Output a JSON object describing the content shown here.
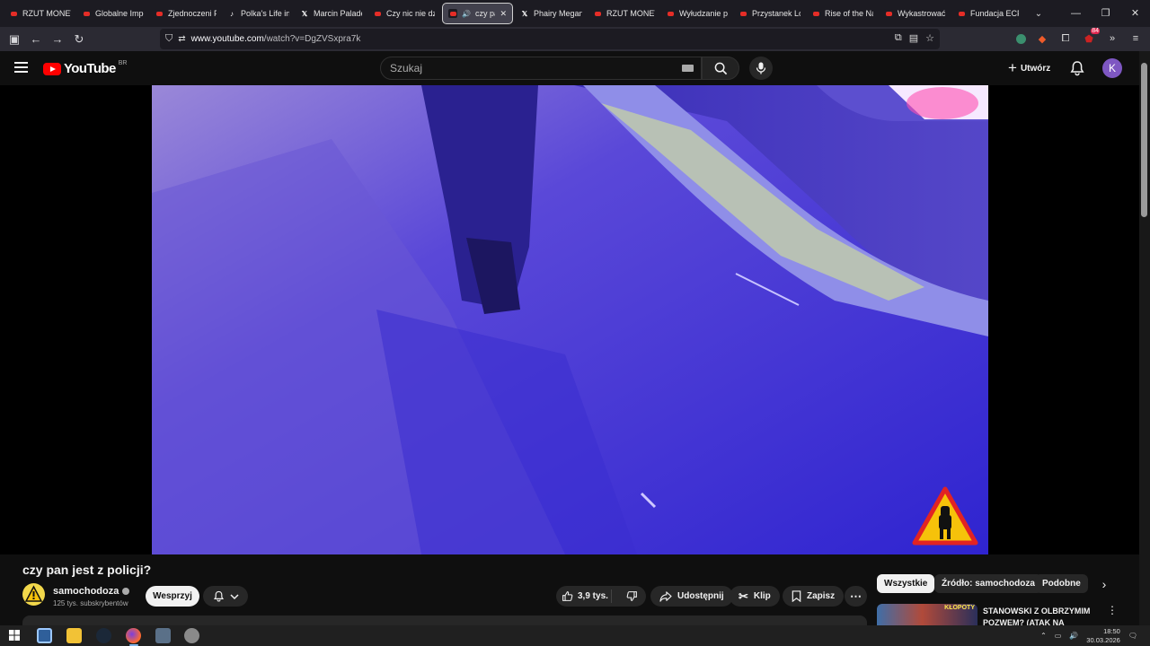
{
  "browser": {
    "tabs": [
      {
        "title": "RZUT MONETA",
        "icon": "youtube-icon"
      },
      {
        "title": "Globalne Impe",
        "icon": "youtube-icon"
      },
      {
        "title": "Zjednoczeni Pr",
        "icon": "youtube-icon"
      },
      {
        "title": "Polka's Life in",
        "icon": "tiktok-icon"
      },
      {
        "title": "Marcin Palade",
        "icon": "x-icon"
      },
      {
        "title": "Czy nic nie dzi",
        "icon": "youtube-icon"
      },
      {
        "title": "czy pan",
        "icon": "youtube-icon",
        "active": true
      },
      {
        "title": "Phairy Megan",
        "icon": "x-icon"
      },
      {
        "title": "RZUT MONETA",
        "icon": "youtube-icon"
      },
      {
        "title": "Wyłudzanie pie",
        "icon": "youtube-icon"
      },
      {
        "title": "Przystanek Lon",
        "icon": "youtube-icon"
      },
      {
        "title": "Rise of the Na",
        "icon": "youtube-icon"
      },
      {
        "title": "Wykastrować I",
        "icon": "youtube-icon"
      },
      {
        "title": "Fundacja ECPU",
        "icon": "youtube-icon"
      }
    ],
    "url_domain": "www.youtube.com",
    "url_path": "/watch?v=DgZVSxpra7k",
    "extension_badge": "84"
  },
  "youtube": {
    "logo_text": "YouTube",
    "country_code": "BR",
    "search_placeholder": "Szukaj",
    "create_label": "Utwórz",
    "avatar_letter": "K"
  },
  "video": {
    "title": "czy pan jest z policji?",
    "channel_name": "samochodoza",
    "subscribers": "125 tys. subskrybentów",
    "support_label": "Wesprzyj",
    "likes": "3,9 tys.",
    "share_label": "Udostępnij",
    "clip_label": "Klip",
    "save_label": "Zapisz"
  },
  "sidebar": {
    "chips": [
      "Wszystkie",
      "Źródło: samochodoza",
      "Podobne"
    ],
    "recommended": {
      "title": "STANOWSKI Z OLBRZYMIM POZWEM? (ATAK NA",
      "thumb_text": "KŁOPOTY"
    }
  },
  "taskbar": {
    "time": "18:50",
    "date": "30.03.2026"
  },
  "colors": {
    "yt_red": "#ff0000",
    "page_bg": "#0f0f0f",
    "avatar": "#7e57c2"
  }
}
